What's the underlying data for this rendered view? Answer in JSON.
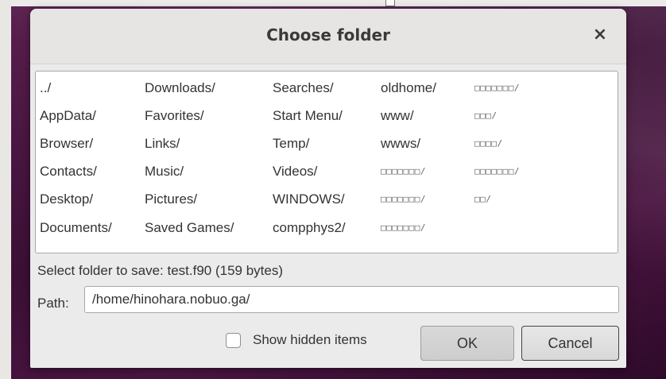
{
  "dialog": {
    "title": "Choose folder",
    "close_glyph": "×"
  },
  "folders": {
    "col0": [
      "../",
      "AppData/",
      "Browser/",
      "Contacts/",
      "Desktop/",
      "Documents/"
    ],
    "col1": [
      "Downloads/",
      "Favorites/",
      "Links/",
      "Music/",
      "Pictures/",
      "Saved Games/"
    ],
    "col2": [
      "Searches/",
      "Start Menu/",
      "Temp/",
      "Videos/",
      "WINDOWS/",
      "compphys2/"
    ],
    "col3": [
      "oldhome/",
      "www/",
      "wwws/",
      "□□□□□□□/",
      "□□□□□□□/",
      "□□□□□□□/"
    ],
    "col4": [
      "□□□□□□□/",
      "□□□/",
      "□□□□/",
      "□□□□□□□/",
      "□□/"
    ]
  },
  "status": {
    "select_text": "Select folder to save: test.f90 (159 bytes)"
  },
  "path": {
    "label": "Path:",
    "value": "/home/hinohara.nobuo.ga/"
  },
  "options": {
    "show_hidden_label": "Show hidden items",
    "show_hidden_checked": false
  },
  "buttons": {
    "ok": "OK",
    "cancel": "Cancel"
  },
  "icons": {
    "close": "close-icon"
  }
}
